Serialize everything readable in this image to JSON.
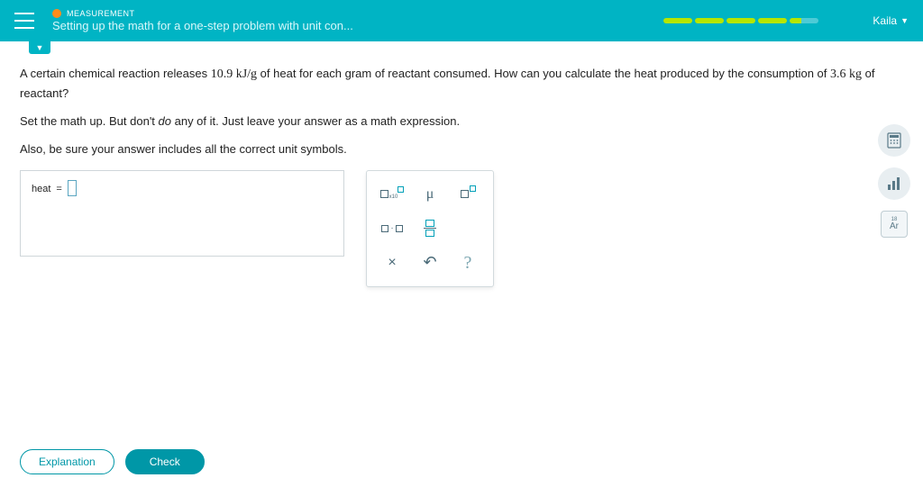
{
  "header": {
    "category": "MEASUREMENT",
    "title": "Setting up the math for a one-step problem with unit con...",
    "user": "Kaila"
  },
  "problem": {
    "line1_a": "A certain chemical reaction releases ",
    "rate": "10.9",
    "rate_unit": " kJ/g",
    "line1_b": " of heat for each gram of reactant consumed. How can you calculate the heat produced by the consumption of ",
    "mass": "3.6",
    "mass_unit": " kg",
    "line1_c": " of reactant?",
    "line2_a": "Set the math up. But don't ",
    "line2_em": "do",
    "line2_b": " any of it. Just leave your answer as a math expression.",
    "line3": "Also, be sure your answer includes all the correct unit symbols."
  },
  "answer": {
    "label": "heat",
    "equals": "="
  },
  "toolbar": {
    "mu": "μ",
    "times": "×",
    "undo": "↶",
    "help": "?"
  },
  "footer": {
    "explanation": "Explanation",
    "check": "Check"
  },
  "rtools": {
    "ar": "Ar"
  }
}
